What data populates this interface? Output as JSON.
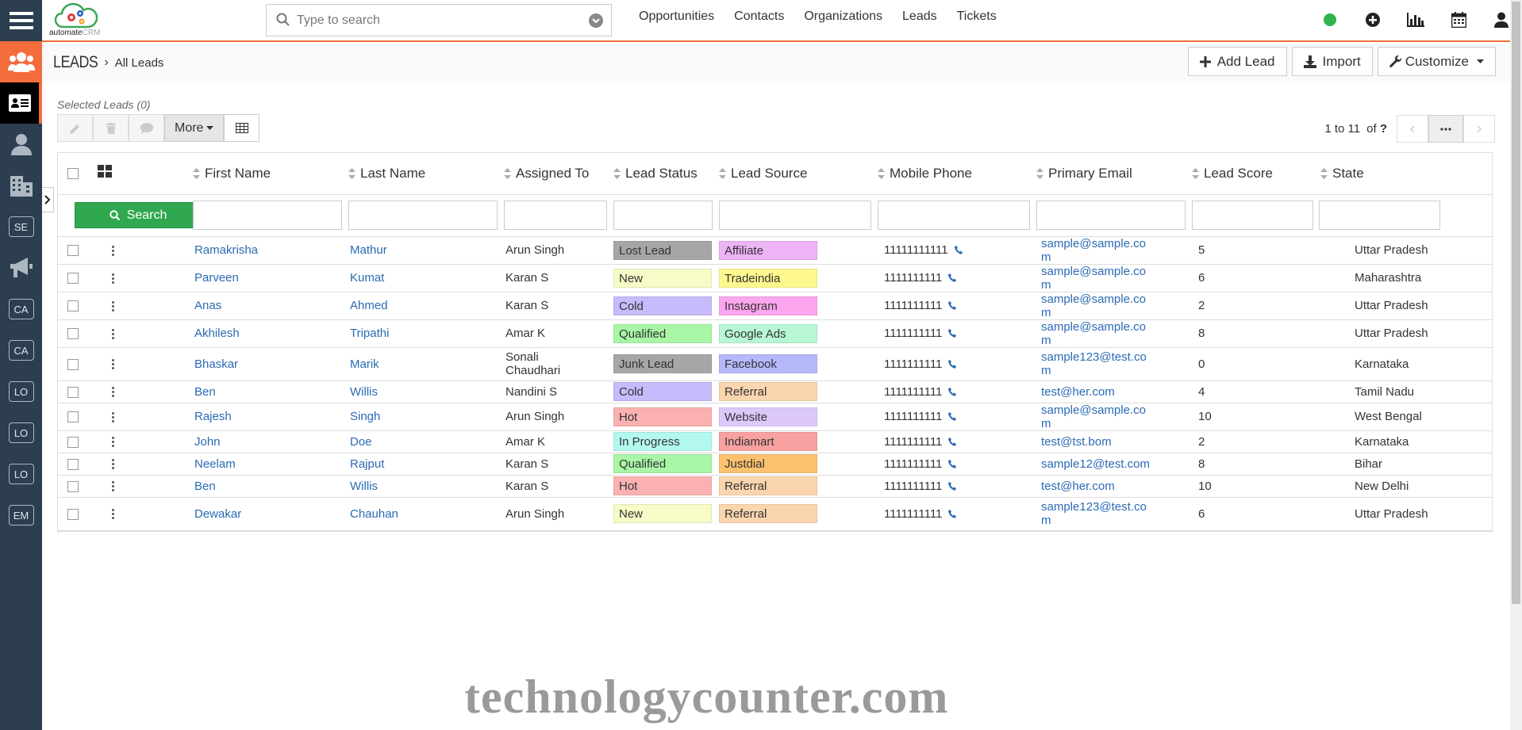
{
  "app": {
    "logo_text_main": "automate",
    "logo_text_sub": "CRM"
  },
  "search": {
    "placeholder": "Type to search",
    "value": ""
  },
  "nav": {
    "items": [
      "Opportunities",
      "Contacts",
      "Organizations",
      "Leads",
      "Tickets"
    ]
  },
  "sidebar": {
    "abbr_items": [
      "SE",
      "CA",
      "CA",
      "LO",
      "LO",
      "LO",
      "EM"
    ]
  },
  "header": {
    "module": "LEADS",
    "sub": "All Leads",
    "add_label": "Add Lead",
    "import_label": "Import",
    "customize_label": "Customize"
  },
  "toolbar": {
    "selected_label": "Selected Leads (0)",
    "more_label": "More",
    "range": "1 to 11",
    "of_label": "of",
    "of_value": "?"
  },
  "table": {
    "columns": [
      "First Name",
      "Last Name",
      "Assigned To",
      "Lead Status",
      "Lead Source",
      "Mobile Phone",
      "Primary Email",
      "Lead Score",
      "State"
    ],
    "search_label": "Search",
    "rows": [
      {
        "first": "Ramakrisha",
        "last": "Mathur",
        "assigned": "Arun Singh",
        "status": "Lost Lead",
        "status_color": "#a6a6a6",
        "source": "Affiliate",
        "source_color": "#ecb3f5",
        "phone": "11111111111",
        "email": "sample@sample.com",
        "score": "5",
        "state": "Uttar Pradesh"
      },
      {
        "first": "Parveen",
        "last": "Kumat",
        "assigned": "Karan S",
        "status": "New",
        "status_color": "#f6fbc7",
        "source": "Tradeindia",
        "source_color": "#fdf98e",
        "phone": "1111111111",
        "email": "sample@sample.com",
        "score": "6",
        "state": "Maharashtra"
      },
      {
        "first": "Anas",
        "last": "Ahmed",
        "assigned": "Karan S",
        "status": "Cold",
        "status_color": "#c8bbfb",
        "source": "Instagram",
        "source_color": "#fba6ee",
        "phone": "1111111111",
        "email": "sample@sample.com",
        "score": "2",
        "state": "Uttar Pradesh"
      },
      {
        "first": "Akhilesh",
        "last": "Tripathi",
        "assigned": "Amar K",
        "status": "Qualified",
        "status_color": "#a8f6a6",
        "source": "Google Ads",
        "source_color": "#b7f7d4",
        "phone": "1111111111",
        "email": "sample@sample.com",
        "score": "8",
        "state": "Uttar Pradesh"
      },
      {
        "first": "Bhaskar",
        "last": "Marik",
        "assigned": "Sonali Chaudhari",
        "status": "Junk Lead",
        "status_color": "#a6a6a6",
        "source": "Facebook",
        "source_color": "#b5b8fb",
        "phone": "1111111111",
        "email": "sample123@test.com",
        "score": "0",
        "state": "Karnataka"
      },
      {
        "first": "Ben",
        "last": "Willis",
        "assigned": "Nandini S",
        "status": "Cold",
        "status_color": "#c8bbfb",
        "source": "Referral",
        "source_color": "#fad5ae",
        "phone": "1111111111",
        "email": "test@her.com",
        "score": "4",
        "state": "Tamil Nadu"
      },
      {
        "first": "Rajesh",
        "last": "Singh",
        "assigned": "Arun Singh",
        "status": "Hot",
        "status_color": "#fbb1b1",
        "source": "Website",
        "source_color": "#dcc9fa",
        "phone": "1111111111",
        "email": "sample@sample.com",
        "score": "10",
        "state": "West Bengal"
      },
      {
        "first": "John",
        "last": "Doe",
        "assigned": "Amar K",
        "status": "In Progress",
        "status_color": "#b3f8ee",
        "source": "Indiamart",
        "source_color": "#f8a1a1",
        "phone": "1111111111",
        "email": "test@tst.bom",
        "score": "2",
        "state": "Karnataka"
      },
      {
        "first": "Neelam",
        "last": "Rajput",
        "assigned": "Karan S",
        "status": "Qualified",
        "status_color": "#a8f6a6",
        "source": "Justdial",
        "source_color": "#fcc16e",
        "phone": "1111111111",
        "email": "sample12@test.com",
        "score": "8",
        "state": "Bihar"
      },
      {
        "first": "Ben",
        "last": "Willis",
        "assigned": "Karan S",
        "status": "Hot",
        "status_color": "#fbb1b1",
        "source": "Referral",
        "source_color": "#fad5ae",
        "phone": "1111111111",
        "email": "test@her.com",
        "score": "10",
        "state": "New Delhi"
      },
      {
        "first": "Dewakar",
        "last": "Chauhan",
        "assigned": "Arun Singh",
        "status": "New",
        "status_color": "#f6fbc7",
        "source": "Referral",
        "source_color": "#fad5ae",
        "phone": "1111111111",
        "email": "sample123@test.com",
        "score": "6",
        "state": "Uttar Pradesh"
      }
    ]
  },
  "watermark": "technologycounter.com"
}
